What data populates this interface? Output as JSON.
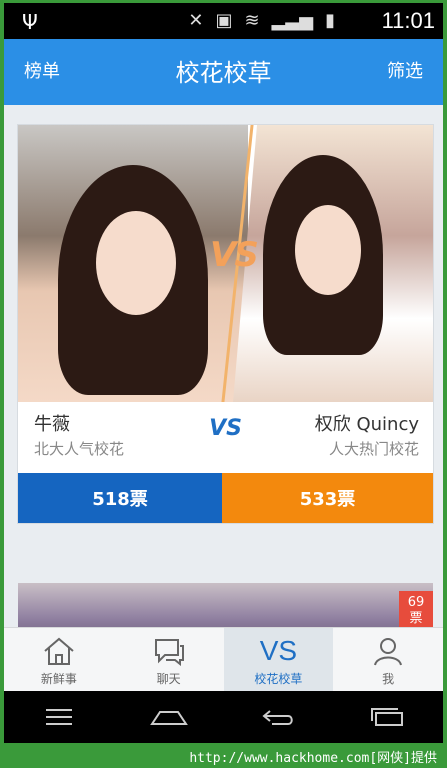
{
  "status_bar": {
    "time": "11:01"
  },
  "app_bar": {
    "left": "榜单",
    "title": "校花校草",
    "right": "筛选"
  },
  "card": {
    "left": {
      "name": "牛薇",
      "subtitle": "北大人气校花",
      "votes": "518票"
    },
    "right": {
      "name": "权欣    Quincy",
      "subtitle": "人大热门校花",
      "votes": "533票"
    },
    "vs_label": "VS",
    "vs_photo_label": "VS"
  },
  "card2": {
    "badge_number": "69",
    "badge_unit": "票"
  },
  "tabs": [
    {
      "label": "新鲜事"
    },
    {
      "label": "聊天"
    },
    {
      "label": "校花校草",
      "icon_text": "VS"
    },
    {
      "label": "我"
    }
  ],
  "footer": {
    "watermark": "http://www.hackhome.com[网侠]提供"
  },
  "colors": {
    "blue": "#2b8fe6",
    "vote_blue": "#1565c0",
    "vote_orange": "#f3890d"
  }
}
